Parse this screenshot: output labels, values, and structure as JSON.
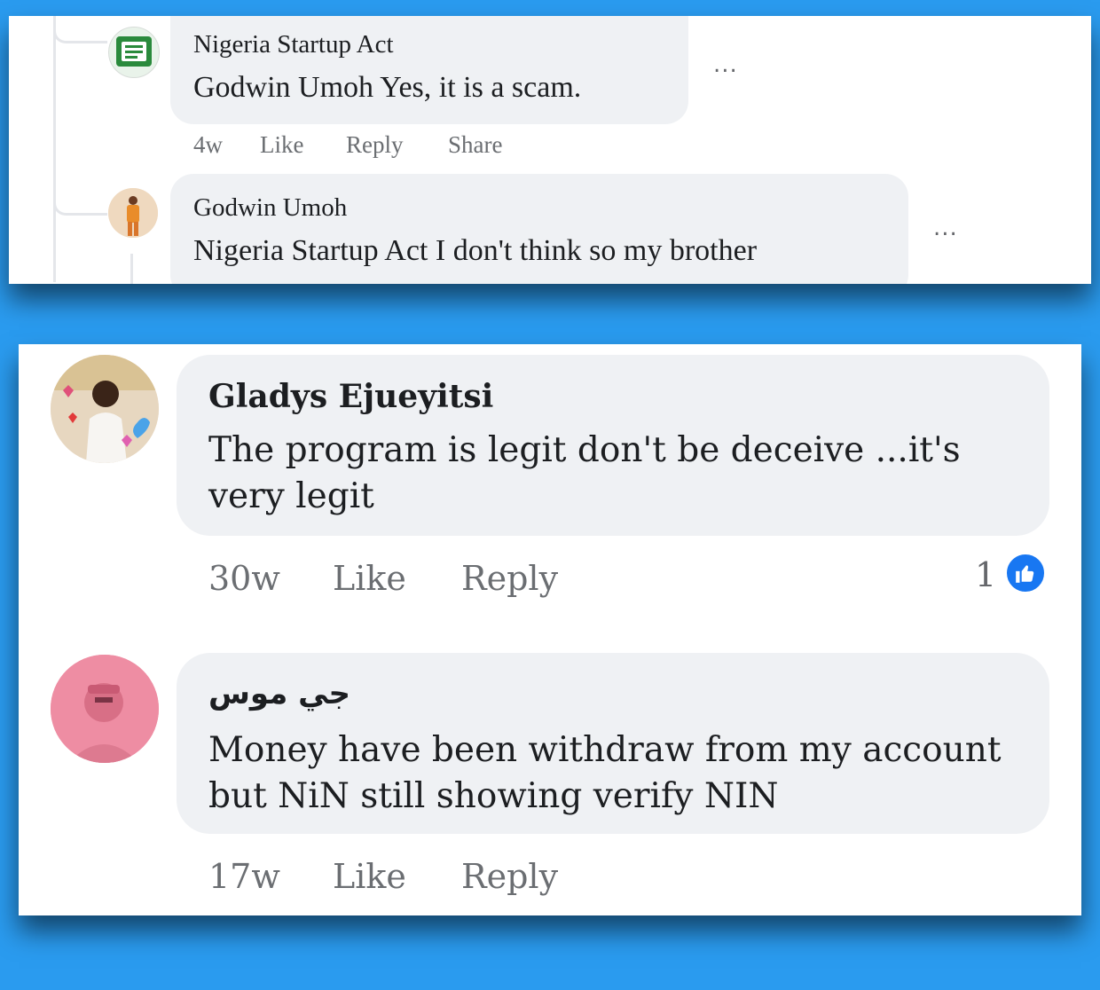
{
  "top_panel": {
    "comments": [
      {
        "author": "Nigeria Startup Act",
        "text": "Godwin Umoh Yes, it is a scam.",
        "time": "4w",
        "actions": [
          "Like",
          "Reply",
          "Share"
        ],
        "more": "..."
      },
      {
        "author": "Godwin Umoh",
        "text": "Nigeria Startup Act I don't think so my brother",
        "more": "..."
      }
    ]
  },
  "bottom_panel": {
    "comments": [
      {
        "author": "Gladys Ejueyitsi",
        "text": "The program is legit don't be deceive ...it's very legit",
        "time": "30w",
        "actions": [
          "Like",
          "Reply"
        ],
        "reaction_count": "1",
        "reaction_icon": "thumbs-up-icon"
      },
      {
        "author": "جي موس",
        "text": "Money have been withdraw from my account but NiN still showing verify NIN",
        "time": "17w",
        "actions": [
          "Like",
          "Reply"
        ]
      }
    ]
  },
  "colors": {
    "background": "#2a9bef",
    "bubble": "#eff1f4",
    "like_blue": "#1877f2",
    "meta_gray": "#6b6e72"
  }
}
